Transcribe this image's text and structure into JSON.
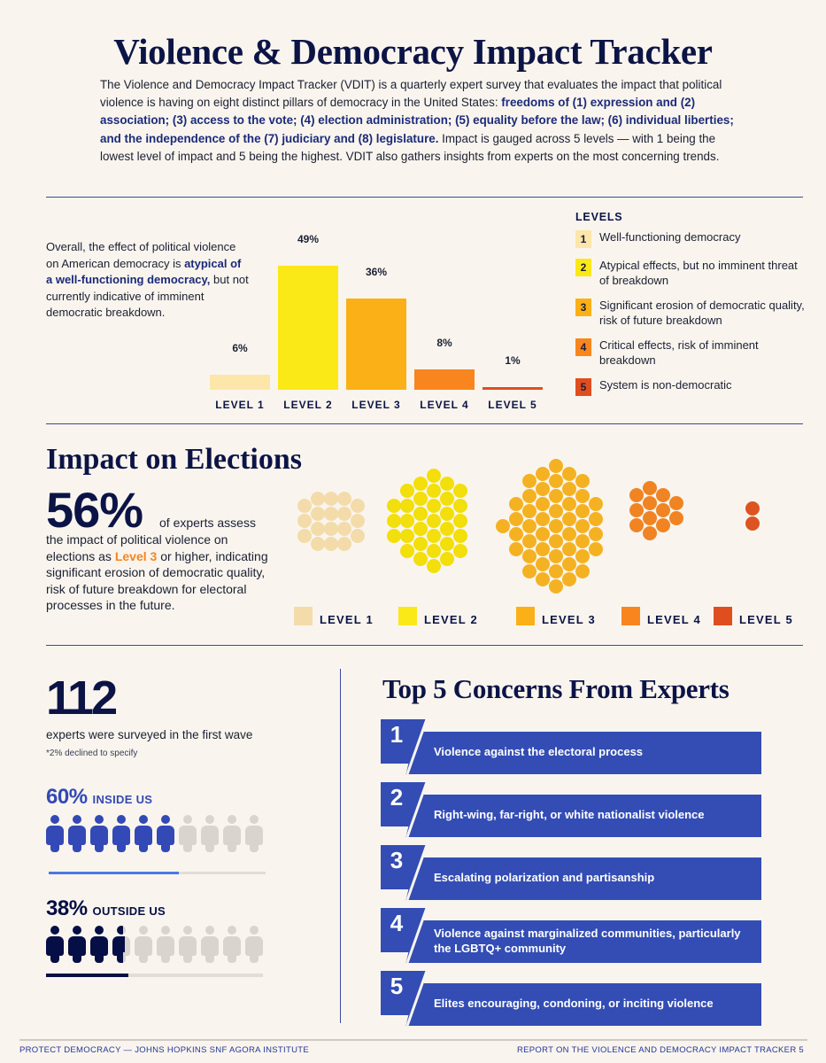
{
  "header": {
    "title": "Violence & Democracy Impact Tracker",
    "intro_plain_1": "The Violence and Democracy Impact Tracker (VDIT) is a quarterly expert survey that evaluates the impact that political violence is having on eight distinct pillars of democracy in the United States: ",
    "intro_bold": "freedoms of (1) expression and (2) association; (3) access to the vote; (4) election administration; (5) equality before the law; (6) individual liberties; and the independence of the (7) judiciary and (8) legislature.",
    "intro_plain_2": " Impact is gauged across 5 levels — with 1 being the lowest level of impact and 5 being the highest. VDIT also gathers insights from experts on the most concerning trends."
  },
  "overall": {
    "text_1": "Overall, the effect of political violence on American democracy is ",
    "text_bold": "atypical of a well-functioning democracy,",
    "text_2": " but not currently indicative of imminent democratic breakdown."
  },
  "chart_data": {
    "type": "bar",
    "title": "",
    "xlabel": "",
    "ylabel": "",
    "categories": [
      "LEVEL 1",
      "LEVEL 2",
      "LEVEL 3",
      "LEVEL 4",
      "LEVEL 5"
    ],
    "values": [
      6,
      49,
      36,
      8,
      1
    ],
    "value_labels": [
      "6%",
      "49%",
      "36%",
      "8%",
      "1%"
    ],
    "colors": [
      "#fde6a9",
      "#fbe817",
      "#fbb017",
      "#f9851f",
      "#e04e20"
    ],
    "ylim": [
      0,
      49
    ],
    "grid": false
  },
  "levels": {
    "title": "LEVELS",
    "items": [
      {
        "num": "1",
        "text": "Well-functioning democracy",
        "color": "#fde6a9"
      },
      {
        "num": "2",
        "text": "Atypical effects, but no imminent threat of breakdown",
        "color": "#fbe817"
      },
      {
        "num": "3",
        "text": "Significant erosion of democratic quality, risk of future breakdown",
        "color": "#fbb017"
      },
      {
        "num": "4",
        "text": "Critical effects, risk of imminent breakdown",
        "color": "#f9851f"
      },
      {
        "num": "5",
        "text": "System is non-democratic",
        "color": "#e04e20"
      }
    ]
  },
  "elections": {
    "title": "Impact on Elections",
    "big_stat": "56%",
    "after_stat": "of experts assess",
    "text_1": "the impact of political violence on elections as ",
    "text_highlight": "Level 3",
    "text_2": " or higher, indicating significant erosion of democratic quality, risk of future breakdown for electoral processes in the future.",
    "clusters": [
      {
        "label": "LEVEL 1",
        "color": "#f3dcaa",
        "swatch": "#f3dcaa",
        "column_counts": [
          3,
          4,
          4,
          4,
          3
        ]
      },
      {
        "label": "LEVEL 2",
        "color": "#f2df0b",
        "swatch": "#fbe817",
        "column_counts": [
          3,
          5,
          6,
          7,
          6,
          5
        ]
      },
      {
        "label": "LEVEL 3",
        "color": "#f4b223",
        "swatch": "#fbb017",
        "column_counts": [
          1,
          4,
          7,
          8,
          9,
          8,
          7,
          4
        ]
      },
      {
        "label": "LEVEL 4",
        "color": "#f08423",
        "swatch": "#f9851f",
        "column_counts": [
          3,
          4,
          3,
          2
        ]
      },
      {
        "label": "LEVEL 5",
        "color": "#dc5520",
        "swatch": "#e04e20",
        "column_counts": [
          2
        ]
      }
    ]
  },
  "experts": {
    "count": "112",
    "surveyed": "experts were surveyed in the first wave",
    "declined": "*2% declined to specify",
    "inside": {
      "pct": "60%",
      "label": "INSIDE US",
      "value": 0.6,
      "filled_icons": 6,
      "total_icons": 10,
      "color": "#3349b5"
    },
    "outside": {
      "pct": "38%",
      "label": "OUTSIDE US",
      "value": 0.38,
      "filled_icons": 3.7,
      "total_icons": 10,
      "color": "#050e45"
    },
    "icon_empty_color": "#d9d4ce"
  },
  "concerns": {
    "title": "Top 5 Concerns From Experts",
    "color": "#334db5",
    "items": [
      {
        "num": "1",
        "text": "Violence against the electoral process"
      },
      {
        "num": "2",
        "text": "Right-wing, far-right, or white nationalist violence"
      },
      {
        "num": "3",
        "text": "Escalating polarization and partisanship"
      },
      {
        "num": "4",
        "text": "Violence against marginalized communities, particularly the LGBTQ+ community"
      },
      {
        "num": "5",
        "text": "Elites encouraging, condoning, or inciting violence"
      }
    ]
  },
  "footer": {
    "left": "PROTECT DEMOCRACY — JOHNS HOPKINS SNF AGORA INSTITUTE",
    "right": "REPORT ON THE VIOLENCE AND DEMOCRACY IMPACT TRACKER  5"
  }
}
